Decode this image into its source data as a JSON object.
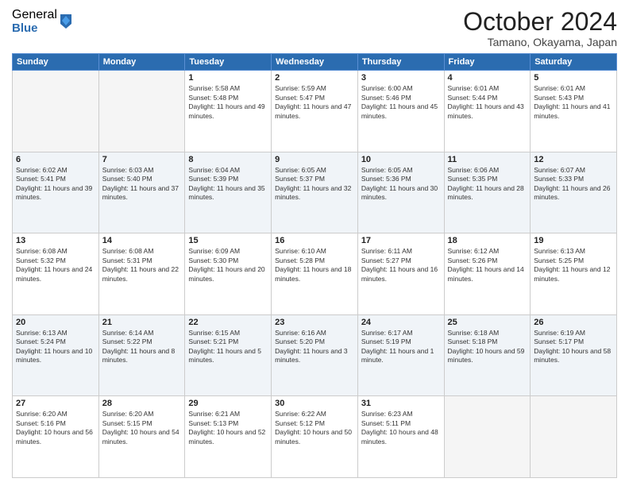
{
  "logo": {
    "general": "General",
    "blue": "Blue"
  },
  "header": {
    "title": "October 2024",
    "subtitle": "Tamano, Okayama, Japan"
  },
  "weekdays": [
    "Sunday",
    "Monday",
    "Tuesday",
    "Wednesday",
    "Thursday",
    "Friday",
    "Saturday"
  ],
  "weeks": [
    [
      {
        "day": "",
        "sunrise": "",
        "sunset": "",
        "daylight": ""
      },
      {
        "day": "",
        "sunrise": "",
        "sunset": "",
        "daylight": ""
      },
      {
        "day": "1",
        "sunrise": "Sunrise: 5:58 AM",
        "sunset": "Sunset: 5:48 PM",
        "daylight": "Daylight: 11 hours and 49 minutes."
      },
      {
        "day": "2",
        "sunrise": "Sunrise: 5:59 AM",
        "sunset": "Sunset: 5:47 PM",
        "daylight": "Daylight: 11 hours and 47 minutes."
      },
      {
        "day": "3",
        "sunrise": "Sunrise: 6:00 AM",
        "sunset": "Sunset: 5:46 PM",
        "daylight": "Daylight: 11 hours and 45 minutes."
      },
      {
        "day": "4",
        "sunrise": "Sunrise: 6:01 AM",
        "sunset": "Sunset: 5:44 PM",
        "daylight": "Daylight: 11 hours and 43 minutes."
      },
      {
        "day": "5",
        "sunrise": "Sunrise: 6:01 AM",
        "sunset": "Sunset: 5:43 PM",
        "daylight": "Daylight: 11 hours and 41 minutes."
      }
    ],
    [
      {
        "day": "6",
        "sunrise": "Sunrise: 6:02 AM",
        "sunset": "Sunset: 5:41 PM",
        "daylight": "Daylight: 11 hours and 39 minutes."
      },
      {
        "day": "7",
        "sunrise": "Sunrise: 6:03 AM",
        "sunset": "Sunset: 5:40 PM",
        "daylight": "Daylight: 11 hours and 37 minutes."
      },
      {
        "day": "8",
        "sunrise": "Sunrise: 6:04 AM",
        "sunset": "Sunset: 5:39 PM",
        "daylight": "Daylight: 11 hours and 35 minutes."
      },
      {
        "day": "9",
        "sunrise": "Sunrise: 6:05 AM",
        "sunset": "Sunset: 5:37 PM",
        "daylight": "Daylight: 11 hours and 32 minutes."
      },
      {
        "day": "10",
        "sunrise": "Sunrise: 6:05 AM",
        "sunset": "Sunset: 5:36 PM",
        "daylight": "Daylight: 11 hours and 30 minutes."
      },
      {
        "day": "11",
        "sunrise": "Sunrise: 6:06 AM",
        "sunset": "Sunset: 5:35 PM",
        "daylight": "Daylight: 11 hours and 28 minutes."
      },
      {
        "day": "12",
        "sunrise": "Sunrise: 6:07 AM",
        "sunset": "Sunset: 5:33 PM",
        "daylight": "Daylight: 11 hours and 26 minutes."
      }
    ],
    [
      {
        "day": "13",
        "sunrise": "Sunrise: 6:08 AM",
        "sunset": "Sunset: 5:32 PM",
        "daylight": "Daylight: 11 hours and 24 minutes."
      },
      {
        "day": "14",
        "sunrise": "Sunrise: 6:08 AM",
        "sunset": "Sunset: 5:31 PM",
        "daylight": "Daylight: 11 hours and 22 minutes."
      },
      {
        "day": "15",
        "sunrise": "Sunrise: 6:09 AM",
        "sunset": "Sunset: 5:30 PM",
        "daylight": "Daylight: 11 hours and 20 minutes."
      },
      {
        "day": "16",
        "sunrise": "Sunrise: 6:10 AM",
        "sunset": "Sunset: 5:28 PM",
        "daylight": "Daylight: 11 hours and 18 minutes."
      },
      {
        "day": "17",
        "sunrise": "Sunrise: 6:11 AM",
        "sunset": "Sunset: 5:27 PM",
        "daylight": "Daylight: 11 hours and 16 minutes."
      },
      {
        "day": "18",
        "sunrise": "Sunrise: 6:12 AM",
        "sunset": "Sunset: 5:26 PM",
        "daylight": "Daylight: 11 hours and 14 minutes."
      },
      {
        "day": "19",
        "sunrise": "Sunrise: 6:13 AM",
        "sunset": "Sunset: 5:25 PM",
        "daylight": "Daylight: 11 hours and 12 minutes."
      }
    ],
    [
      {
        "day": "20",
        "sunrise": "Sunrise: 6:13 AM",
        "sunset": "Sunset: 5:24 PM",
        "daylight": "Daylight: 11 hours and 10 minutes."
      },
      {
        "day": "21",
        "sunrise": "Sunrise: 6:14 AM",
        "sunset": "Sunset: 5:22 PM",
        "daylight": "Daylight: 11 hours and 8 minutes."
      },
      {
        "day": "22",
        "sunrise": "Sunrise: 6:15 AM",
        "sunset": "Sunset: 5:21 PM",
        "daylight": "Daylight: 11 hours and 5 minutes."
      },
      {
        "day": "23",
        "sunrise": "Sunrise: 6:16 AM",
        "sunset": "Sunset: 5:20 PM",
        "daylight": "Daylight: 11 hours and 3 minutes."
      },
      {
        "day": "24",
        "sunrise": "Sunrise: 6:17 AM",
        "sunset": "Sunset: 5:19 PM",
        "daylight": "Daylight: 11 hours and 1 minute."
      },
      {
        "day": "25",
        "sunrise": "Sunrise: 6:18 AM",
        "sunset": "Sunset: 5:18 PM",
        "daylight": "Daylight: 10 hours and 59 minutes."
      },
      {
        "day": "26",
        "sunrise": "Sunrise: 6:19 AM",
        "sunset": "Sunset: 5:17 PM",
        "daylight": "Daylight: 10 hours and 58 minutes."
      }
    ],
    [
      {
        "day": "27",
        "sunrise": "Sunrise: 6:20 AM",
        "sunset": "Sunset: 5:16 PM",
        "daylight": "Daylight: 10 hours and 56 minutes."
      },
      {
        "day": "28",
        "sunrise": "Sunrise: 6:20 AM",
        "sunset": "Sunset: 5:15 PM",
        "daylight": "Daylight: 10 hours and 54 minutes."
      },
      {
        "day": "29",
        "sunrise": "Sunrise: 6:21 AM",
        "sunset": "Sunset: 5:13 PM",
        "daylight": "Daylight: 10 hours and 52 minutes."
      },
      {
        "day": "30",
        "sunrise": "Sunrise: 6:22 AM",
        "sunset": "Sunset: 5:12 PM",
        "daylight": "Daylight: 10 hours and 50 minutes."
      },
      {
        "day": "31",
        "sunrise": "Sunrise: 6:23 AM",
        "sunset": "Sunset: 5:11 PM",
        "daylight": "Daylight: 10 hours and 48 minutes."
      },
      {
        "day": "",
        "sunrise": "",
        "sunset": "",
        "daylight": ""
      },
      {
        "day": "",
        "sunrise": "",
        "sunset": "",
        "daylight": ""
      }
    ]
  ]
}
